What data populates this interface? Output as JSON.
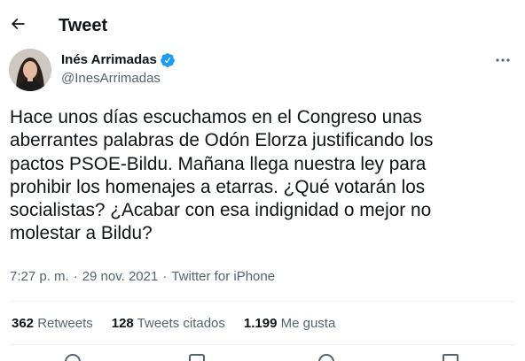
{
  "header": {
    "back_icon": "arrow-left-icon",
    "title": "Tweet"
  },
  "author": {
    "name": "Inés Arrimadas",
    "verified_icon": "verified-badge-icon",
    "handle": "@InesArrimadas"
  },
  "more_icon": "more-options-icon",
  "tweet": {
    "lines": [
      "Hace unos días escuchamos en el Congreso unas",
      "aberrantes palabras de Odón Elorza justificando los",
      "pactos PSOE-Bildu. Mañana llega nuestra ley para",
      "prohibir los homenajes a etarras. ¿Qué votarán los",
      "socialistas? ¿Acabar con esa indignidad o mejor no",
      "molestar a Bildu?"
    ]
  },
  "meta": {
    "time": "7:27 p. m.",
    "separator": "·",
    "date": "29 nov. 2021",
    "source": "Twitter for iPhone"
  },
  "stats": {
    "retweets_count": "362",
    "retweets_label": "Retweets",
    "quotes_count": "128",
    "quotes_label": "Tweets citados",
    "likes_count": "1.199",
    "likes_label": "Me gusta"
  },
  "actions": [
    "reply-icon",
    "retweet-icon",
    "like-icon",
    "share-icon"
  ],
  "colors": {
    "text": "#0f1419",
    "secondary": "#536471",
    "verified": "#1d9bf0",
    "divider": "#eff3f4"
  }
}
